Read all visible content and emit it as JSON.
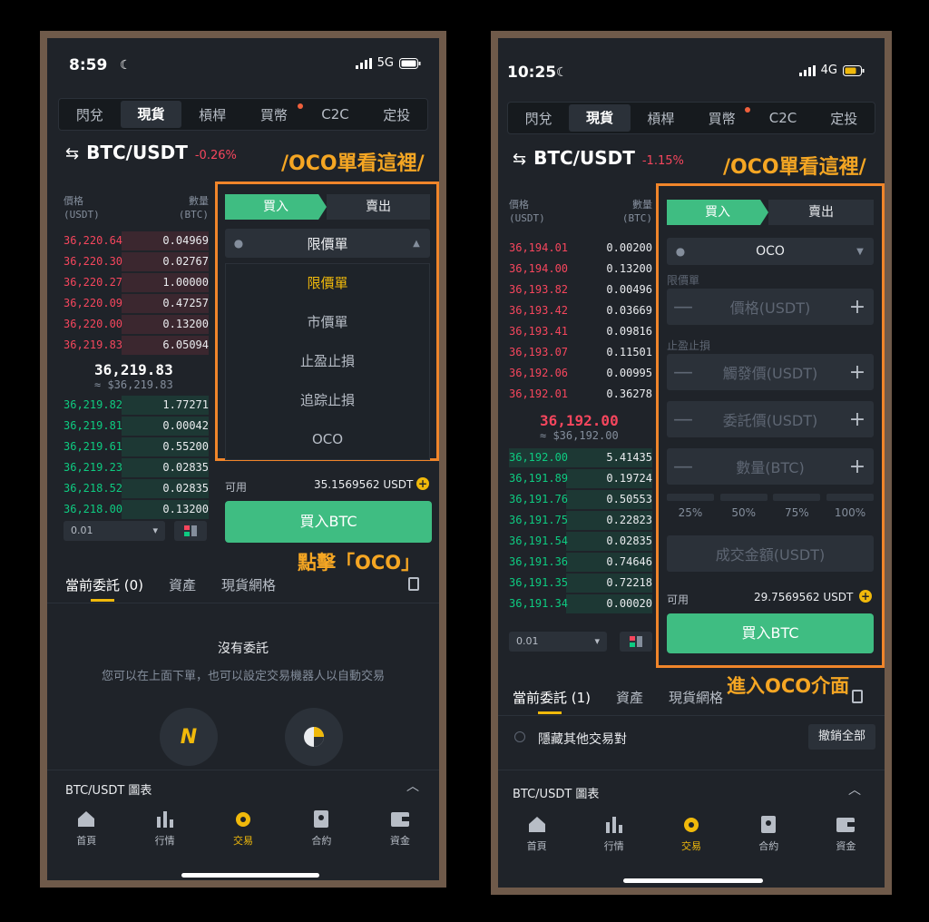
{
  "left": {
    "status": {
      "time": "8:59",
      "network": "5G"
    },
    "tabs": [
      "閃兌",
      "現貨",
      "槓桿",
      "買幣",
      "C2C",
      "定投"
    ],
    "pair": "BTC/USDT",
    "change": "-0.26%",
    "annotation_top": "/OCO單看這裡/",
    "annotation_bottom": "點擊「OCO」",
    "orderbook": {
      "price_header": "價格",
      "price_unit": "(USDT)",
      "qty_header": "數量",
      "qty_unit": "(BTC)",
      "asks": [
        [
          "36,220.64",
          "0.04969"
        ],
        [
          "36,220.30",
          "0.02767"
        ],
        [
          "36,220.27",
          "1.00000"
        ],
        [
          "36,220.09",
          "0.47257"
        ],
        [
          "36,220.00",
          "0.13200"
        ],
        [
          "36,219.83",
          "6.05094"
        ]
      ],
      "mid_price": "36,219.83",
      "mid_fiat": "≈ $36,219.83",
      "bids": [
        [
          "36,219.82",
          "1.77271"
        ],
        [
          "36,219.81",
          "0.00042"
        ],
        [
          "36,219.61",
          "0.55200"
        ],
        [
          "36,219.23",
          "0.02835"
        ],
        [
          "36,218.52",
          "0.02835"
        ],
        [
          "36,218.00",
          "0.13200"
        ]
      ],
      "depth": "0.01"
    },
    "buy_label": "買入",
    "sell_label": "賣出",
    "order_type": "限價單",
    "menu": [
      "限價單",
      "市價單",
      "止盈止損",
      "追踪止損",
      "OCO"
    ],
    "available_label": "可用",
    "available_value": "35.1569562 USDT",
    "buy_button": "買入BTC",
    "bottom_tabs": [
      "當前委託 (0)",
      "資產",
      "現貨網格"
    ],
    "empty_title": "沒有委託",
    "empty_desc": "您可以在上面下單，也可以設定交易機器人以自動交易",
    "chart_bar": "BTC/USDT 圖表",
    "nav": [
      "首頁",
      "行情",
      "交易",
      "合約",
      "資金"
    ]
  },
  "right": {
    "status": {
      "time": "10:25",
      "network": "4G"
    },
    "tabs": [
      "閃兌",
      "現貨",
      "槓桿",
      "買幣",
      "C2C",
      "定投"
    ],
    "pair": "BTC/USDT",
    "change": "-1.15%",
    "annotation_top": "/OCO單看這裡/",
    "annotation_bottom": "進入OCO介面",
    "orderbook": {
      "price_header": "價格",
      "price_unit": "(USDT)",
      "qty_header": "數量",
      "qty_unit": "(BTC)",
      "asks": [
        [
          "36,194.01",
          "0.00200"
        ],
        [
          "36,194.00",
          "0.13200"
        ],
        [
          "36,193.82",
          "0.00496"
        ],
        [
          "36,193.42",
          "0.03669"
        ],
        [
          "36,193.41",
          "0.09816"
        ],
        [
          "36,193.07",
          "0.11501"
        ],
        [
          "36,192.06",
          "0.00995"
        ],
        [
          "36,192.01",
          "0.36278"
        ]
      ],
      "mid_price": "36,192.00",
      "mid_fiat": "≈ $36,192.00",
      "bids": [
        [
          "36,192.00",
          "5.41435"
        ],
        [
          "36,191.89",
          "0.19724"
        ],
        [
          "36,191.76",
          "0.50553"
        ],
        [
          "36,191.75",
          "0.22823"
        ],
        [
          "36,191.54",
          "0.02835"
        ],
        [
          "36,191.36",
          "0.74646"
        ],
        [
          "36,191.35",
          "0.72218"
        ],
        [
          "36,191.34",
          "0.00020"
        ]
      ],
      "depth": "0.01"
    },
    "buy_label": "買入",
    "sell_label": "賣出",
    "order_type": "OCO",
    "limit_label": "限價單",
    "price_placeholder": "價格(USDT)",
    "stop_label": "止盈止損",
    "trigger_placeholder": "觸發價(USDT)",
    "order_placeholder": "委託價(USDT)",
    "amount_placeholder": "數量(BTC)",
    "percents": [
      "25%",
      "50%",
      "75%",
      "100%"
    ],
    "total_placeholder": "成交金額(USDT)",
    "available_label": "可用",
    "available_value": "29.7569562 USDT",
    "buy_button": "買入BTC",
    "bottom_tabs": [
      "當前委託 (1)",
      "資產",
      "現貨網格"
    ],
    "hide_pairs": "隱藏其他交易對",
    "cancel_all": "撤銷全部",
    "chart_bar": "BTC/USDT 圖表",
    "nav": [
      "首頁",
      "行情",
      "交易",
      "合約",
      "資金"
    ]
  }
}
